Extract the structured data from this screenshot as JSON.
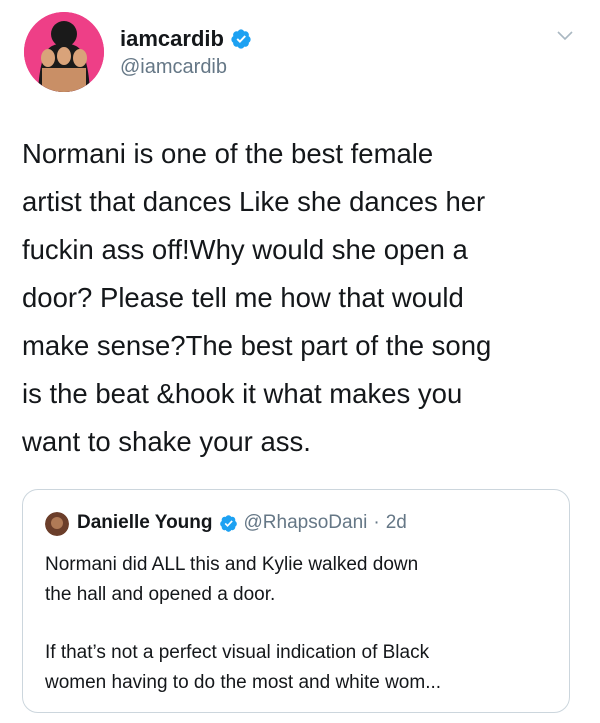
{
  "author": {
    "display_name": "iamcardib",
    "handle": "@iamcardib",
    "avatar_icon": "profile-photo",
    "verified_icon": "verified-badge-icon"
  },
  "tweet": {
    "lines": [
      "Normani is one of the best female",
      "artist that dances Like she dances her",
      "fuckin ass off!Why would she open a",
      "door? Please tell me how that would",
      "make sense?The best part of the song",
      "is the beat &hook  it what makes you",
      "want to shake your ass."
    ]
  },
  "quoted": {
    "display_name": "Danielle Young",
    "handle": "@RhapsoDani",
    "separator": "·",
    "time": "2d",
    "paragraph1": [
      "Normani did ALL this and Kylie walked down",
      "the hall and opened a door."
    ],
    "paragraph2": [
      "If that’s not a perfect visual indication of Black",
      "women having to do the most and white wom..."
    ]
  },
  "colors": {
    "verified": "#1da1f2",
    "secondary_text": "#657786",
    "avatar_bg": "#ee3f87",
    "border": "#ccd6dd"
  }
}
